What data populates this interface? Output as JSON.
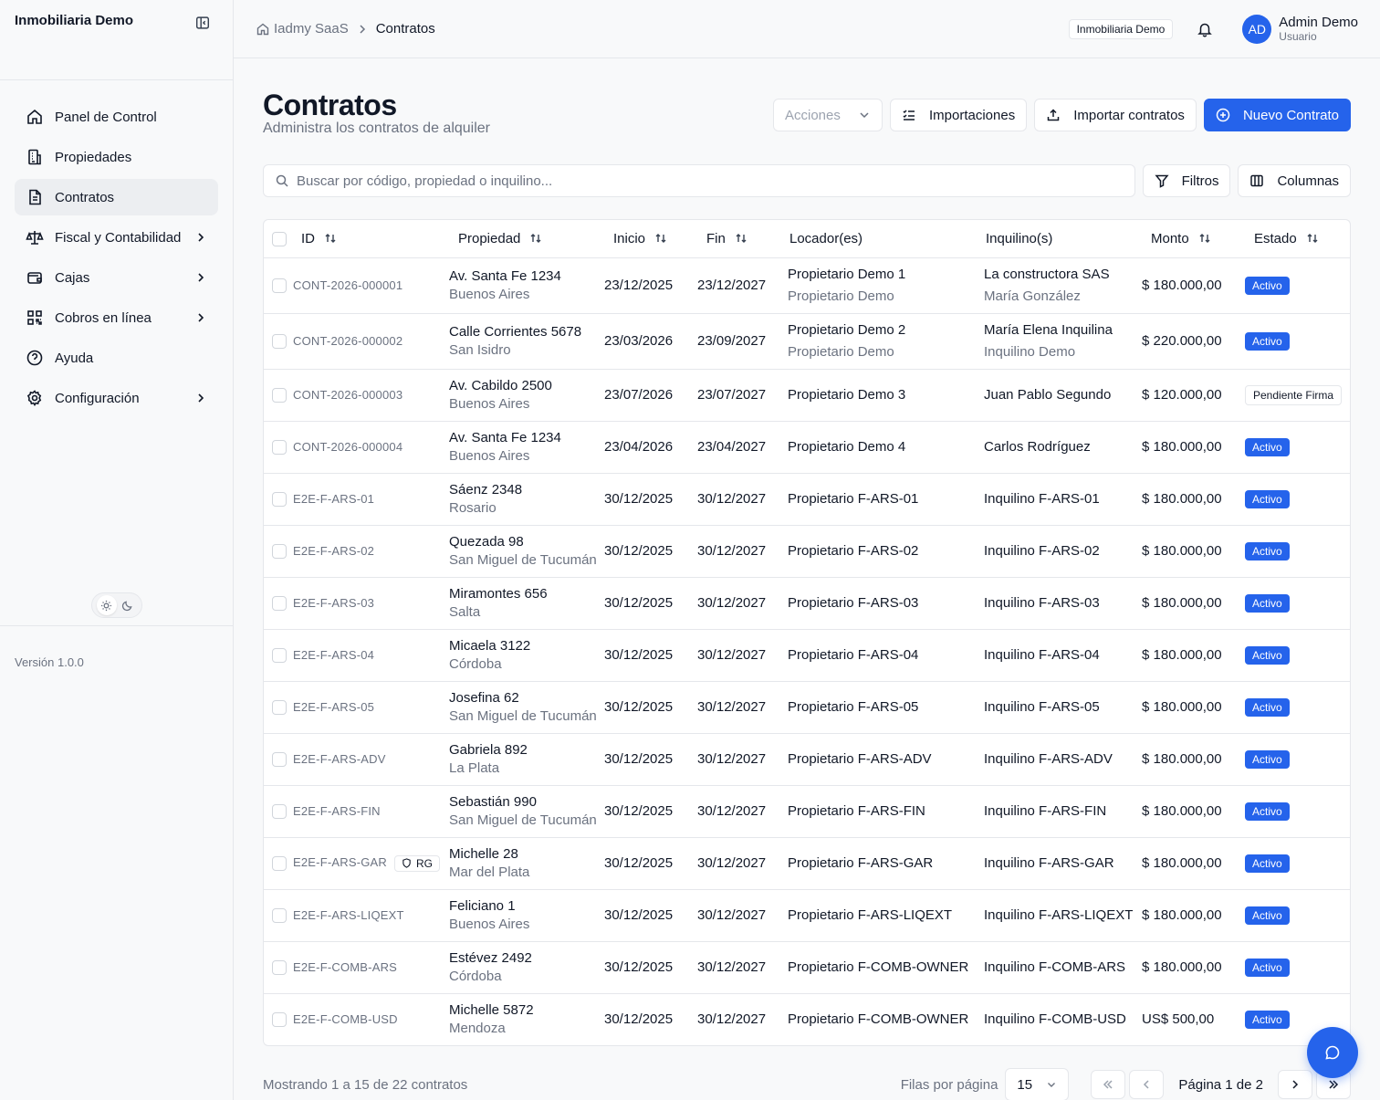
{
  "sidebar": {
    "brand": "Inmobiliaria Demo",
    "items": [
      {
        "label": "Panel de Control",
        "icon": "home-icon"
      },
      {
        "label": "Propiedades",
        "icon": "building-icon"
      },
      {
        "label": "Contratos",
        "icon": "document-icon",
        "active": true
      },
      {
        "label": "Fiscal y Contabilidad",
        "icon": "scale-icon"
      },
      {
        "label": "Cajas",
        "icon": "wallet-icon"
      },
      {
        "label": "Cobros en línea",
        "icon": "qr-icon"
      },
      {
        "label": "Ayuda",
        "icon": "help-icon"
      },
      {
        "label": "Configuración",
        "icon": "gear-icon"
      }
    ],
    "version": "Versión 1.0.0"
  },
  "topbar": {
    "breadcrumb_root": "Iadmy SaaS",
    "breadcrumb_current": "Contratos",
    "org": "Inmobiliaria Demo",
    "avatar_initials": "AD",
    "user_name": "Admin Demo",
    "user_role": "Usuario"
  },
  "page": {
    "title": "Contratos",
    "subtitle": "Administra los contratos de alquiler",
    "actions_placeholder": "Acciones",
    "imports_label": "Importaciones",
    "import_label": "Importar contratos",
    "new_label": "Nuevo Contrato",
    "search_placeholder": "Buscar por código, propiedad o inquilino...",
    "filters_label": "Filtros",
    "columns_label": "Columnas"
  },
  "table": {
    "headers": {
      "id": "ID",
      "propiedad": "Propiedad",
      "inicio": "Inicio",
      "fin": "Fin",
      "locador": "Locador(es)",
      "inquilino": "Inquilino(s)",
      "monto": "Monto",
      "estado": "Estado"
    },
    "rows": [
      {
        "id": "CONT-2026-000001",
        "addr": "Av. Santa Fe 1234",
        "city": "Buenos Aires",
        "start": "23/12/2025",
        "end": "23/12/2027",
        "owner": "Propietario Demo 1",
        "owner2": "Propietario Demo",
        "tenant": "La constructora SAS",
        "tenant2": "María González",
        "amount": "$ 180.000,00",
        "status": "Activo"
      },
      {
        "id": "CONT-2026-000002",
        "addr": "Calle Corrientes 5678",
        "city": "San Isidro",
        "start": "23/03/2026",
        "end": "23/09/2027",
        "owner": "Propietario Demo 2",
        "owner2": "Propietario Demo",
        "tenant": "María Elena Inquilina",
        "tenant2": "Inquilino Demo",
        "amount": "$ 220.000,00",
        "status": "Activo"
      },
      {
        "id": "CONT-2026-000003",
        "addr": "Av. Cabildo 2500",
        "city": "Buenos Aires",
        "start": "23/07/2026",
        "end": "23/07/2027",
        "owner": "Propietario Demo 3",
        "owner2": "",
        "tenant": "Juan Pablo Segundo",
        "tenant2": "",
        "amount": "$ 120.000,00",
        "status": "Pendiente Firma"
      },
      {
        "id": "CONT-2026-000004",
        "addr": "Av. Santa Fe 1234",
        "city": "Buenos Aires",
        "start": "23/04/2026",
        "end": "23/04/2027",
        "owner": "Propietario Demo 4",
        "owner2": "",
        "tenant": "Carlos Rodríguez",
        "tenant2": "",
        "amount": "$ 180.000,00",
        "status": "Activo"
      },
      {
        "id": "E2E-F-ARS-01",
        "addr": "Sáenz 2348",
        "city": "Rosario",
        "start": "30/12/2025",
        "end": "30/12/2027",
        "owner": "Propietario F-ARS-01",
        "owner2": "",
        "tenant": "Inquilino F-ARS-01",
        "tenant2": "",
        "amount": "$ 180.000,00",
        "status": "Activo"
      },
      {
        "id": "E2E-F-ARS-02",
        "addr": "Quezada 98",
        "city": "San Miguel de Tucumán",
        "start": "30/12/2025",
        "end": "30/12/2027",
        "owner": "Propietario F-ARS-02",
        "owner2": "",
        "tenant": "Inquilino F-ARS-02",
        "tenant2": "",
        "amount": "$ 180.000,00",
        "status": "Activo"
      },
      {
        "id": "E2E-F-ARS-03",
        "addr": "Miramontes 656",
        "city": "Salta",
        "start": "30/12/2025",
        "end": "30/12/2027",
        "owner": "Propietario F-ARS-03",
        "owner2": "",
        "tenant": "Inquilino F-ARS-03",
        "tenant2": "",
        "amount": "$ 180.000,00",
        "status": "Activo"
      },
      {
        "id": "E2E-F-ARS-04",
        "addr": "Micaela 3122",
        "city": "Córdoba",
        "start": "30/12/2025",
        "end": "30/12/2027",
        "owner": "Propietario F-ARS-04",
        "owner2": "",
        "tenant": "Inquilino F-ARS-04",
        "tenant2": "",
        "amount": "$ 180.000,00",
        "status": "Activo"
      },
      {
        "id": "E2E-F-ARS-05",
        "addr": "Josefina 62",
        "city": "San Miguel de Tucumán",
        "start": "30/12/2025",
        "end": "30/12/2027",
        "owner": "Propietario F-ARS-05",
        "owner2": "",
        "tenant": "Inquilino F-ARS-05",
        "tenant2": "",
        "amount": "$ 180.000,00",
        "status": "Activo"
      },
      {
        "id": "E2E-F-ARS-ADV",
        "addr": "Gabriela 892",
        "city": "La Plata",
        "start": "30/12/2025",
        "end": "30/12/2027",
        "owner": "Propietario F-ARS-ADV",
        "owner2": "",
        "tenant": "Inquilino F-ARS-ADV",
        "tenant2": "",
        "amount": "$ 180.000,00",
        "status": "Activo"
      },
      {
        "id": "E2E-F-ARS-FIN",
        "addr": "Sebastián 990",
        "city": "San Miguel de Tucumán",
        "start": "30/12/2025",
        "end": "30/12/2027",
        "owner": "Propietario F-ARS-FIN",
        "owner2": "",
        "tenant": "Inquilino F-ARS-FIN",
        "tenant2": "",
        "amount": "$ 180.000,00",
        "status": "Activo"
      },
      {
        "id": "E2E-F-ARS-GAR",
        "rg": "RG",
        "addr": "Michelle 28",
        "city": "Mar del Plata",
        "start": "30/12/2025",
        "end": "30/12/2027",
        "owner": "Propietario F-ARS-GAR",
        "owner2": "",
        "tenant": "Inquilino F-ARS-GAR",
        "tenant2": "",
        "amount": "$ 180.000,00",
        "status": "Activo"
      },
      {
        "id": "E2E-F-ARS-LIQEXT",
        "addr": "Feliciano 1",
        "city": "Buenos Aires",
        "start": "30/12/2025",
        "end": "30/12/2027",
        "owner": "Propietario F-ARS-LIQEXT",
        "owner2": "",
        "tenant": "Inquilino F-ARS-LIQEXT",
        "tenant2": "",
        "amount": "$ 180.000,00",
        "status": "Activo"
      },
      {
        "id": "E2E-F-COMB-ARS",
        "addr": "Estévez 2492",
        "city": "Córdoba",
        "start": "30/12/2025",
        "end": "30/12/2027",
        "owner": "Propietario F-COMB-OWNER",
        "owner2": "",
        "tenant": "Inquilino F-COMB-ARS",
        "tenant2": "",
        "amount": "$ 180.000,00",
        "status": "Activo"
      },
      {
        "id": "E2E-F-COMB-USD",
        "addr": "Michelle 5872",
        "city": "Mendoza",
        "start": "30/12/2025",
        "end": "30/12/2027",
        "owner": "Propietario F-COMB-OWNER",
        "owner2": "",
        "tenant": "Inquilino F-COMB-USD",
        "tenant2": "",
        "amount": "US$ 500,00",
        "status": "Activo"
      }
    ]
  },
  "pager": {
    "info": "Mostrando 1 a 15 de 22 contratos",
    "rows_per_page_label": "Filas por página",
    "rows_per_page": "15",
    "page_label": "Página 1 de 2"
  },
  "colors": {
    "accent": "#2563eb"
  }
}
